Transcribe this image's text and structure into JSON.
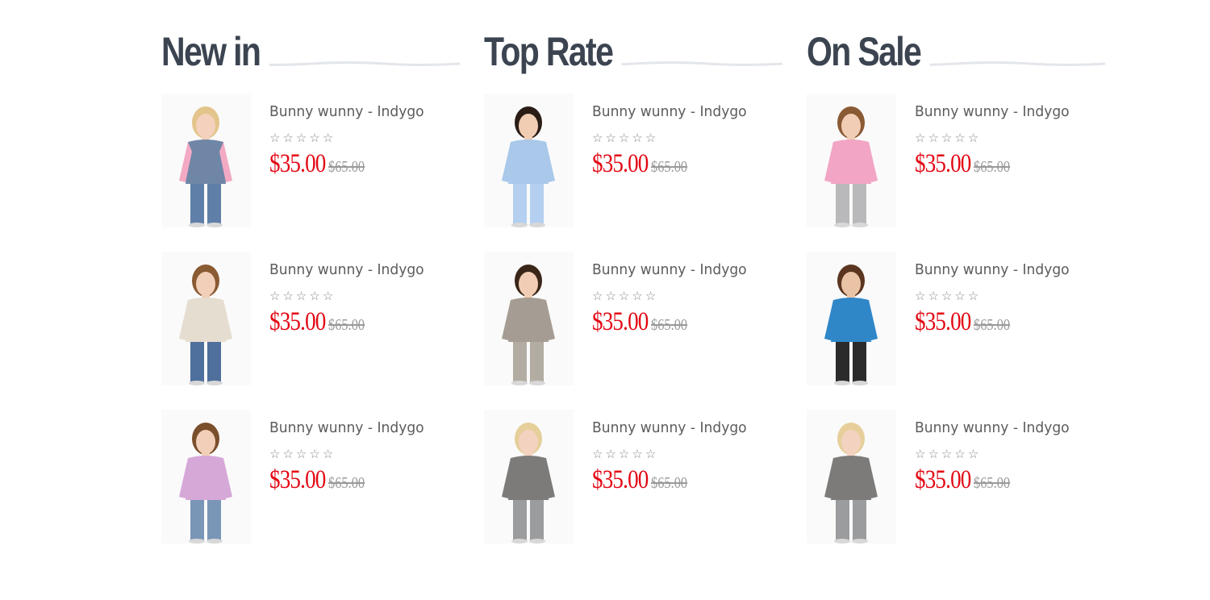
{
  "sections": [
    {
      "title": "New in",
      "products": [
        {
          "name": "Bunny wunny - Indygo",
          "rating": 0,
          "price": "$35.00",
          "old_price": "$65.00",
          "colors": {
            "hair": "#e3c48a",
            "top": "#6f86a6",
            "sleeve": "#f3a9c4",
            "bottom": "#5f7fa8",
            "skin": "#f3d1bd"
          }
        },
        {
          "name": "Bunny wunny - Indygo",
          "rating": 0,
          "price": "$35.00",
          "old_price": "$65.00",
          "colors": {
            "hair": "#8a5a32",
            "top": "#e4ddd0",
            "sleeve": "#e4ddd0",
            "bottom": "#4f6f9c",
            "skin": "#f1cfb8"
          }
        },
        {
          "name": "Bunny wunny - Indygo",
          "rating": 0,
          "price": "$35.00",
          "old_price": "$65.00",
          "colors": {
            "hair": "#7a4f2c",
            "top": "#d6a8d8",
            "sleeve": "#d6a8d8",
            "bottom": "#7a96b7",
            "skin": "#f2cfb8"
          }
        }
      ]
    },
    {
      "title": "Top Rate",
      "products": [
        {
          "name": "Bunny wunny - Indygo",
          "rating": 0,
          "price": "$35.00",
          "old_price": "$65.00",
          "colors": {
            "hair": "#2a1d16",
            "top": "#a9c8ea",
            "sleeve": "#a9c8ea",
            "bottom": "#b4cff0",
            "skin": "#f1cdb3"
          }
        },
        {
          "name": "Bunny wunny - Indygo",
          "rating": 0,
          "price": "$35.00",
          "old_price": "$65.00",
          "colors": {
            "hair": "#3a2618",
            "top": "#a59d93",
            "sleeve": "#a59d93",
            "bottom": "#b3aca3",
            "skin": "#f0cdb4"
          }
        },
        {
          "name": "Bunny wunny - Indygo",
          "rating": 0,
          "price": "$35.00",
          "old_price": "$65.00",
          "colors": {
            "hair": "#e6cf9a",
            "top": "#7d7b7a",
            "sleeve": "#7d7b7a",
            "bottom": "#9b9c9e",
            "skin": "#f3d3c0"
          }
        }
      ]
    },
    {
      "title": "On Sale",
      "products": [
        {
          "name": "Bunny wunny - Indygo",
          "rating": 0,
          "price": "$35.00",
          "old_price": "$65.00",
          "colors": {
            "hair": "#8a5a34",
            "top": "#f2a5c4",
            "sleeve": "#f2a5c4",
            "bottom": "#b9b9bb",
            "skin": "#f1cdb6"
          }
        },
        {
          "name": "Bunny wunny - Indygo",
          "rating": 0,
          "price": "$35.00",
          "old_price": "$65.00",
          "colors": {
            "hair": "#5a3620",
            "top": "#2f87c8",
            "sleeve": "#2f87c8",
            "bottom": "#2b2b2b",
            "skin": "#eac3a6"
          }
        },
        {
          "name": "Bunny wunny - Indygo",
          "rating": 0,
          "price": "$35.00",
          "old_price": "$65.00",
          "colors": {
            "hair": "#e6cf9a",
            "top": "#7d7b7a",
            "sleeve": "#7d7b7a",
            "bottom": "#9b9c9e",
            "skin": "#f3d3c0"
          }
        }
      ]
    }
  ],
  "colors": {
    "title": "#3b4450",
    "price": "#e30613",
    "old_price": "#9a9a9a",
    "product_name": "#5c5c5c",
    "star": "#8a8a8a",
    "wave": "#e3e6ea"
  },
  "icons": {
    "rating_star": "star-outline-icon"
  }
}
